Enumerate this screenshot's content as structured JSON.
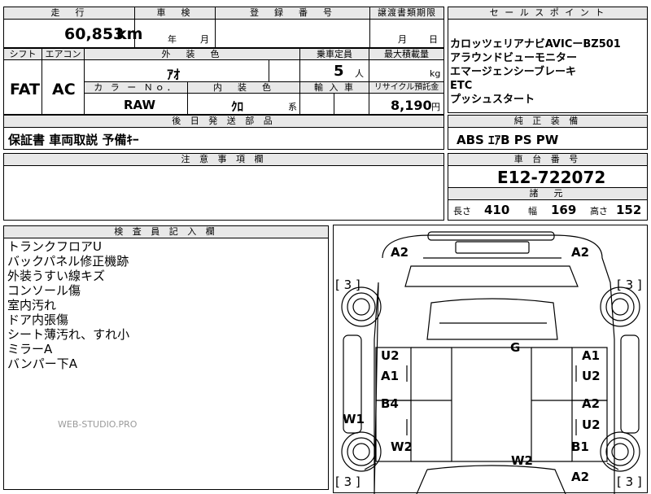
{
  "header": {
    "mileage_label": "走　行",
    "inspection_label": "車　検",
    "registration_label": "登　録　番　号",
    "transfer_label": "譲渡書類期限",
    "sales_point_label": "セ ー ル ス ポ イ ン ト"
  },
  "mileage": {
    "value": "60,853",
    "unit": "km"
  },
  "inspection": {
    "year_label": "年",
    "month_label": "月"
  },
  "transfer": {
    "month_label": "月",
    "day_label": "日"
  },
  "row2": {
    "shift_label": "シフト",
    "aircon_label": "エアコン",
    "exterior_label": "外　装　色",
    "capacity_label": "乗車定員",
    "maxload_label": "最大積載量",
    "shift_value": "FAT",
    "aircon_value": "AC",
    "exterior_value": "ｱｵ",
    "capacity_value": "5",
    "capacity_unit": "人",
    "maxload_unit": "kg",
    "color_no_label": "カ ラ ー Ｎｏ．",
    "interior_label": "内　装　色",
    "import_label": "輸 入 車",
    "recycle_label": "リサイクル預託金",
    "color_no_value": "RAW",
    "interior_value": "ｸﾛ",
    "interior_suffix": "系",
    "recycle_value": "8,190",
    "recycle_unit": "円"
  },
  "sales_points": [
    "カロッツェリアナビAVICーBZ501",
    "アラウンドビューモニター",
    "エマージェンシーブレーキ",
    "ETC",
    "プッシュスタート"
  ],
  "accessories": {
    "label": "後 日 発 送 部 品",
    "value": "保証書 車両取説 予備ｷｰ"
  },
  "genuine": {
    "label": "純 正 装 備",
    "value": "ABS ｴｱB PS PW"
  },
  "caution": {
    "label": "注 意 事 項 欄"
  },
  "chassis": {
    "label": "車 台 番 号",
    "value": "E12-722072"
  },
  "dimensions": {
    "label": "諸　元",
    "length_label": "長さ",
    "length_value": "410",
    "width_label": "幅",
    "width_value": "169",
    "height_label": "高さ",
    "height_value": "152"
  },
  "inspector": {
    "label": "検 査 員 記 入 欄",
    "notes": [
      "トランクフロアU",
      "バックパネル修正機跡",
      "外装うすい線キズ",
      "コンソール傷",
      "室内汚れ",
      "ドア内張傷",
      "シート薄汚れ、すれ小",
      "ミラーA",
      "バンパー下A"
    ]
  },
  "watermark": "WEB-STUDIO.PRO",
  "diagram": {
    "marks": {
      "rear_left": "A2",
      "rear_right": "A2",
      "tire_rl": "[ 3 ]",
      "tire_rr": "[ 3 ]",
      "trunk": "G",
      "left_rear_door_1": "U2",
      "left_rear_door_2": "A1",
      "right_rear_door_1": "A1",
      "right_rear_door_2": "U2",
      "left_front_door": "B4",
      "right_front_door_1": "A2",
      "right_front_door_2": "U2",
      "left_sill": "W1",
      "left_front_fender": "W2",
      "hood": "W2",
      "right_front_fender": "B1",
      "front_right": "A2",
      "tire_fl": "[ 3 ]",
      "tire_fr": "[ 3 ]"
    }
  }
}
